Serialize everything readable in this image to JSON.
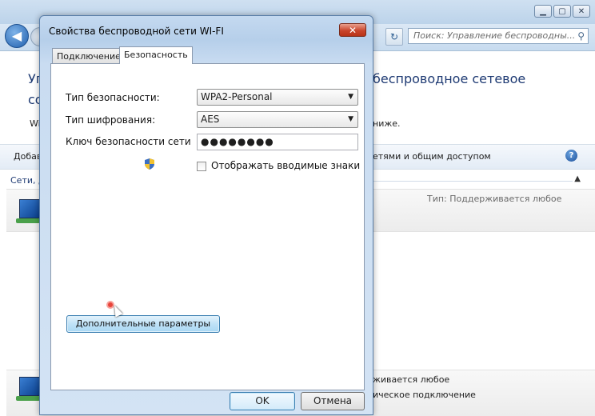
{
  "background_window": {
    "search_placeholder": "Поиск: Управление беспроводны...",
    "heading_left_1": "Уп",
    "heading_left_2": "со",
    "heading_right": "беспроводное сетевое",
    "subtext_left": "Wi",
    "subtext_right": "ниже.",
    "toolbar_left": "Добав",
    "toolbar_right": "етями и общим доступом",
    "group_label": "Сети, д",
    "row1_type": "Тип: Поддерживается любое",
    "row2_line1": "живается любое",
    "row2_line2": "ическое подключение",
    "window_controls": {
      "minimize": "▁",
      "maximize": "▢",
      "close": "✕"
    }
  },
  "dialog": {
    "title": "Свойства беспроводной сети WI-FI",
    "close": "✕",
    "tabs": [
      {
        "label": "Подключение",
        "active": false
      },
      {
        "label": "Безопасность",
        "active": true
      }
    ],
    "security_type_label": "Тип безопасности:",
    "security_type_value": "WPA2-Personal",
    "encryption_type_label": "Тип шифрования:",
    "encryption_type_value": "AES",
    "network_key_label": "Ключ безопасности сети",
    "network_key_value": "●●●●●●●●",
    "show_chars_label": "Отображать вводимые знаки",
    "show_chars_checked": false,
    "advanced_button": "Дополнительные параметры",
    "ok_button": "OK",
    "cancel_button": "Отмена"
  }
}
